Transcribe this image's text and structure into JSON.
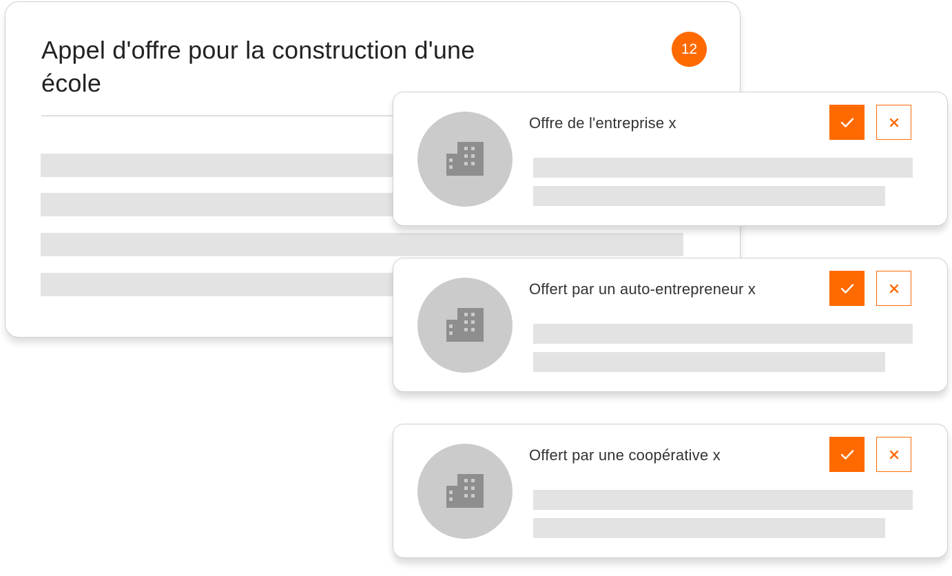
{
  "tender": {
    "title": "Appel d'offre pour la construction d'une école",
    "badge_count": "12"
  },
  "offers": [
    {
      "name": "Offre de l'entreprise x",
      "avatar_icon": "building-icon",
      "accept_icon": "check-icon",
      "reject_icon": "close-icon"
    },
    {
      "name": "Offert par un auto-entrepreneur x",
      "avatar_icon": "building-icon",
      "accept_icon": "check-icon",
      "reject_icon": "close-icon"
    },
    {
      "name": "Offert par une coopérative x",
      "avatar_icon": "building-icon",
      "accept_icon": "check-icon",
      "reject_icon": "close-icon"
    }
  ],
  "colors": {
    "accent": "#ff6a00",
    "skeleton": "#e3e3e3",
    "avatar": "#cbcbcb",
    "icon": "#8e8e8e"
  }
}
